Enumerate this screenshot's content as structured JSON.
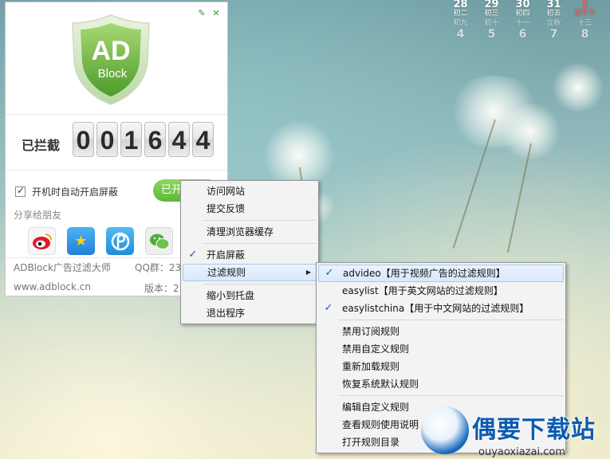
{
  "calendar": {
    "row1": [
      {
        "day": "28",
        "lunar": "初二",
        "red": false
      },
      {
        "day": "29",
        "lunar": "初三",
        "red": false
      },
      {
        "day": "30",
        "lunar": "初四",
        "red": false
      },
      {
        "day": "31",
        "lunar": "初五",
        "red": false
      },
      {
        "day": "1",
        "lunar": "建军节",
        "red": true
      }
    ],
    "row2": [
      {
        "day": "4",
        "lunar": "初九",
        "red": false
      },
      {
        "day": "5",
        "lunar": "初十",
        "red": false
      },
      {
        "day": "6",
        "lunar": "十一",
        "red": false
      },
      {
        "day": "7",
        "lunar": "立秋",
        "red": false
      },
      {
        "day": "8",
        "lunar": "十三",
        "red": false
      }
    ]
  },
  "adblock": {
    "logo_top": "AD",
    "logo_bottom": "Block",
    "blocked_label": "已拦截",
    "counter_digits": [
      "0",
      "0",
      "1",
      "6",
      "4",
      "4"
    ],
    "autostart_label": "开机时自动开启屏蔽",
    "enable_button": "已开启",
    "share_label": "分享给朋友",
    "product_name": "ADBlock广告过滤大师",
    "qq_group": "QQ群：23",
    "website": "www.adblock.cn",
    "version": "版本：2"
  },
  "context_menu": {
    "items": [
      {
        "label": "访问网站",
        "checked": false,
        "submenu": false,
        "highlight": false
      },
      {
        "label": "提交反馈",
        "checked": false,
        "submenu": false,
        "highlight": false
      },
      {
        "sep": true
      },
      {
        "label": "清理浏览器缓存",
        "checked": false,
        "submenu": false,
        "highlight": false
      },
      {
        "sep": true
      },
      {
        "label": "开启屏蔽",
        "checked": true,
        "submenu": false,
        "highlight": false
      },
      {
        "label": "过滤规则",
        "checked": false,
        "submenu": true,
        "highlight": true
      },
      {
        "sep": true
      },
      {
        "label": "缩小到托盘",
        "checked": false,
        "submenu": false,
        "highlight": false
      },
      {
        "label": "退出程序",
        "checked": false,
        "submenu": false,
        "highlight": false
      }
    ]
  },
  "rules_submenu": {
    "items": [
      {
        "label": "advideo【用于视频广告的过滤规则】",
        "checked": true,
        "highlight": true
      },
      {
        "label": "easylist【用于英文网站的过滤规则】",
        "checked": false,
        "highlight": false
      },
      {
        "label": "easylistchina【用于中文网站的过滤规则】",
        "checked": true,
        "highlight": false
      },
      {
        "sep": true
      },
      {
        "label": "禁用订阅规则",
        "checked": false,
        "highlight": false
      },
      {
        "label": "禁用自定义规则",
        "checked": false,
        "highlight": false
      },
      {
        "label": "重新加载规则",
        "checked": false,
        "highlight": false
      },
      {
        "label": "恢复系统默认规则",
        "checked": false,
        "highlight": false
      },
      {
        "sep": true
      },
      {
        "label": "编辑自定义规则",
        "checked": false,
        "highlight": false
      },
      {
        "label": "查看规则使用说明",
        "checked": false,
        "highlight": false
      },
      {
        "label": "打开规则目录",
        "checked": false,
        "highlight": false
      }
    ]
  },
  "watermark": {
    "title": "偶要下载站",
    "url": "ouyaoxiazai.com"
  },
  "colors": {
    "accent_green": "#5cb83a",
    "menu_check": "#1f5aa8",
    "watermark_blue": "#0c5bb0"
  }
}
